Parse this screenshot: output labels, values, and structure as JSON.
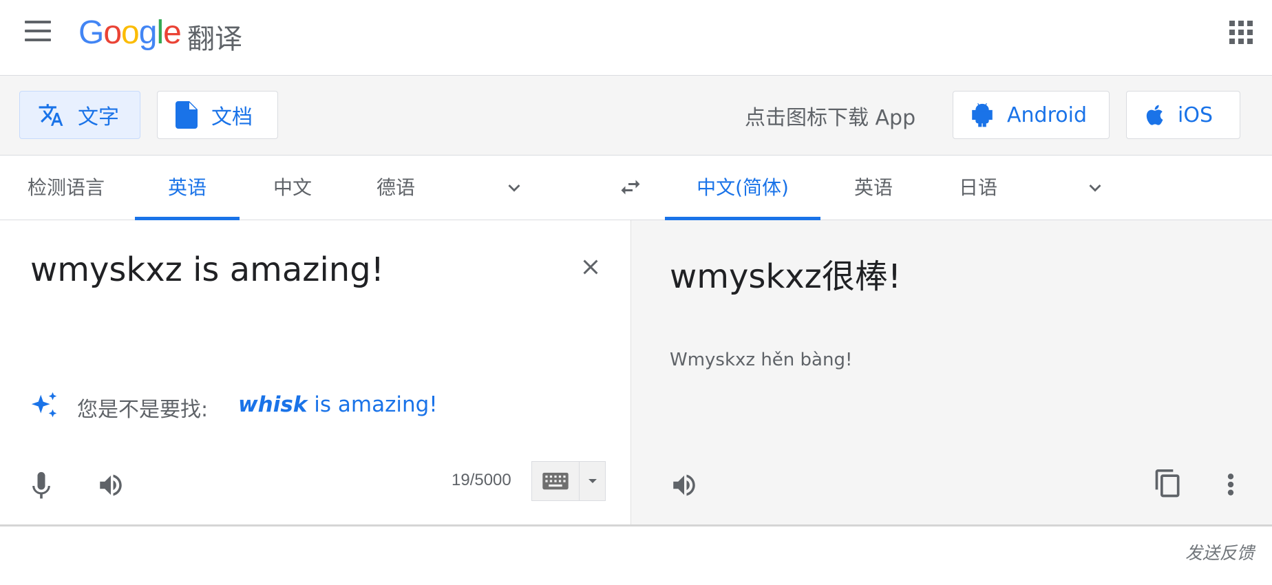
{
  "header": {
    "logo": {
      "g1": "G",
      "o1": "o",
      "o2": "o",
      "g2": "g",
      "l": "l",
      "e": "e"
    },
    "product": "翻译",
    "icons": [
      "menu-icon",
      "apps-grid-icon"
    ]
  },
  "mode_bar": {
    "text_tab": "文字",
    "document_tab": "文档",
    "download_prompt": "点击图标下载 App",
    "android_label": "Android",
    "ios_label": "iOS"
  },
  "source_langs": {
    "detect": "检测语言",
    "english": "英语",
    "chinese": "中文",
    "german": "德语",
    "active": "英语"
  },
  "target_langs": {
    "chinese_simplified": "中文(简体)",
    "english": "英语",
    "japanese": "日语",
    "active": "中文(简体)"
  },
  "source": {
    "text": "wmyskxz is amazing!",
    "did_you_mean_label": "您是不是要找:",
    "suggestion_bold": "whisk",
    "suggestion_rest": " is amazing!",
    "char_count": "19/5000"
  },
  "target": {
    "text": "wmyskxz很棒!",
    "romanization": "Wmyskxz hěn bàng!"
  },
  "footer": {
    "feedback": "发送反馈"
  },
  "colors": {
    "accent": "#1a73e8",
    "icon_gray": "#5f6368",
    "panel_gray": "#f5f5f5"
  }
}
